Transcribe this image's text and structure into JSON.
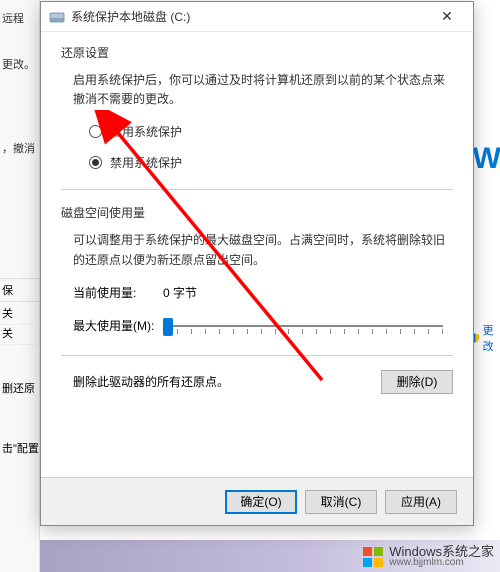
{
  "dialog": {
    "title": "系统保护本地磁盘 (C:)",
    "close_glyph": "✕",
    "restore_section_title": "还原设置",
    "restore_desc": "启用系统保护后，你可以通过及时将计算机还原到以前的某个状态点来撤消不需要的更改。",
    "radio_enable": "启用系统保护",
    "radio_disable": "禁用系统保护",
    "radio_selected": "disable",
    "disk_section_title": "磁盘空间使用量",
    "disk_desc": "可以调整用于系统保护的最大磁盘空间。占满空间时，系统将删除较旧的还原点以便为新还原点留出空间。",
    "current_usage_label": "当前使用量:",
    "current_usage_value": "0 字节",
    "max_usage_label": "最大使用量(M):",
    "slider_position_percent": 2,
    "delete_text": "删除此驱动器的所有还原点。",
    "delete_btn": "删除(D)",
    "ok_btn": "确定(O)",
    "cancel_btn": "取消(C)",
    "apply_btn": "应用(A)"
  },
  "bg_left": {
    "t远程": "远程",
    "t更改": "更改。",
    "t撤消": "，撤消",
    "t保": "保",
    "t关1": "关",
    "t关2": "关",
    "t删还原": "删还原",
    "t击配置": "击\"配置"
  },
  "bg_right": {
    "blue_text": "OW",
    "link_text": "更改"
  },
  "watermark": {
    "line1": "Windows系统之家",
    "line2": "www.bjjmlm.com"
  }
}
